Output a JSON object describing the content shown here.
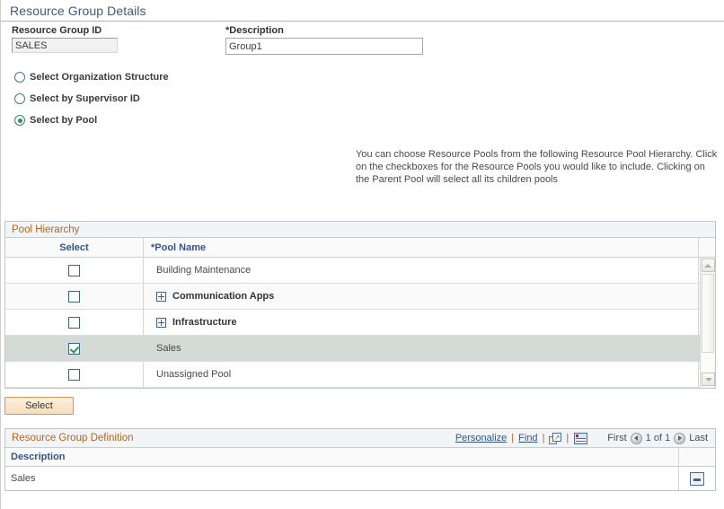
{
  "page": {
    "title": "Resource Group Details"
  },
  "fields": {
    "group_id": {
      "label": "Resource Group ID",
      "value": "SALES"
    },
    "description": {
      "label": "Description",
      "required_mark": "*",
      "value": "Group1",
      "placeholder": ""
    }
  },
  "options": {
    "items": [
      {
        "label": "Select Organization Structure",
        "selected": false
      },
      {
        "label": "Select by Supervisor ID",
        "selected": false
      },
      {
        "label": "Select by Pool",
        "selected": true
      }
    ]
  },
  "helper": {
    "text": "You can choose Resource Pools from the following Resource Pool Hierarchy. Click on the checkboxes for the Resource Pools you would like to include. Clicking on the Parent Pool will select all its children pools"
  },
  "pool_grid": {
    "caption": "Pool Hierarchy",
    "columns": {
      "select": "Select",
      "pool_name": "*Pool Name"
    },
    "rows": [
      {
        "checked": false,
        "expandable": false,
        "name": "Building Maintenance",
        "selected": false
      },
      {
        "checked": false,
        "expandable": true,
        "name": "Communication Apps",
        "selected": false
      },
      {
        "checked": false,
        "expandable": true,
        "name": "Infrastructure",
        "selected": false
      },
      {
        "checked": true,
        "expandable": false,
        "name": "Sales",
        "selected": true
      },
      {
        "checked": false,
        "expandable": false,
        "name": "Unassigned Pool",
        "selected": false
      }
    ]
  },
  "actions": {
    "select_button": "Select"
  },
  "definition_grid": {
    "caption": "Resource Group Definition",
    "toolbar": {
      "personalize": "Personalize",
      "find": "Find",
      "sep1": "|",
      "sep2": "|",
      "sep3": "|",
      "zoom_icon": "view-all-icon",
      "download_icon": "download-spreadsheet-icon"
    },
    "pager": {
      "first": "First",
      "count": "1 of 1",
      "last": "Last",
      "prev_icon": "previous-page-icon",
      "next_icon": "next-page-icon"
    },
    "columns": {
      "description": "Description"
    },
    "rows": [
      {
        "description": "Sales",
        "action": "minus-button"
      }
    ]
  },
  "colors": {
    "caption_orange": "#b5651d",
    "header_blue": "#33548a",
    "title_blue": "#41587c",
    "selected_row": "#d4dad4",
    "check_green": "#2f9b36",
    "button_peach": "#f7dfbd"
  }
}
